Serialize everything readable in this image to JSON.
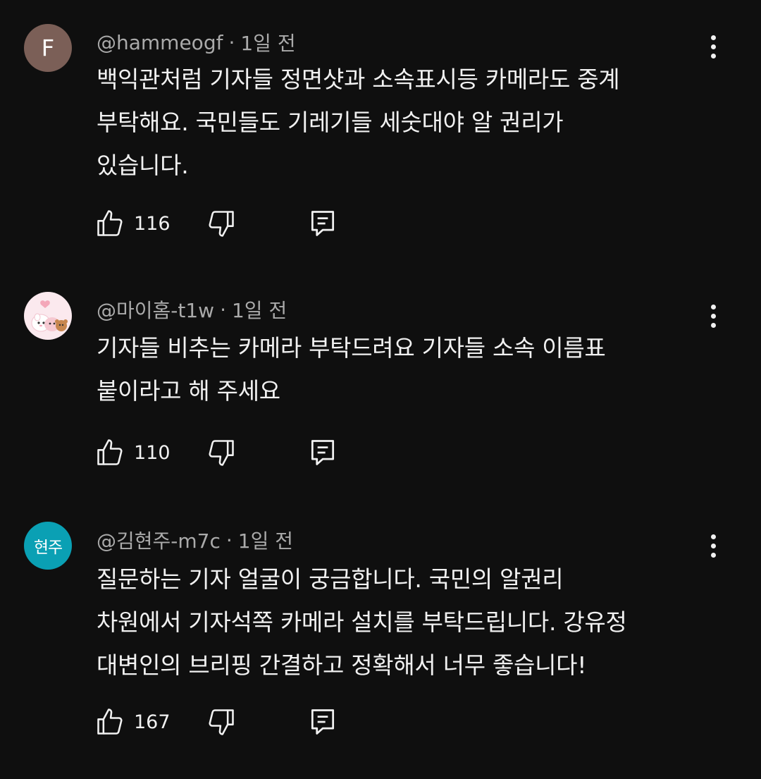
{
  "comments": [
    {
      "avatar": {
        "type": "letter",
        "text": "F",
        "bg": "#7b5f57"
      },
      "handle": "@hammeogf",
      "separator": "·",
      "time": "1일 전",
      "text": "백익관처럼 기자들 정면샷과 소속표시등 카메라도 중계\n부탁해요. 국민들도 기레기들 세숫대야 알 권리가\n있습니다.",
      "likes": "116"
    },
    {
      "avatar": {
        "type": "image",
        "bg": "#fbe9ee"
      },
      "handle": "@마이홈-t1w",
      "separator": "·",
      "time": "1일 전",
      "text": "기자들 비추는 카메라 부탁드려요 기자들 소속 이름표\n붙이라고 해 주세요",
      "likes": "110"
    },
    {
      "avatar": {
        "type": "text",
        "text": "현주",
        "bg": "#0aa0b4"
      },
      "handle": "@김현주-m7c",
      "separator": "·",
      "time": "1일 전",
      "text": "질문하는 기자 얼굴이 궁금합니다. 국민의 알권리\n차원에서 기자석쪽 카메라 설치를 부탁드립니다. 강유정\n대변인의 브리핑 간결하고 정확해서 너무 좋습니다!",
      "likes": "167"
    }
  ],
  "icons": {
    "like": "thumbs-up-icon",
    "dislike": "thumbs-down-icon",
    "reply": "reply-icon",
    "more": "more-vertical-icon"
  },
  "colors": {
    "background": "#0f0f0f",
    "text": "#f1f1f1",
    "secondary_text": "#aaaaaa"
  }
}
